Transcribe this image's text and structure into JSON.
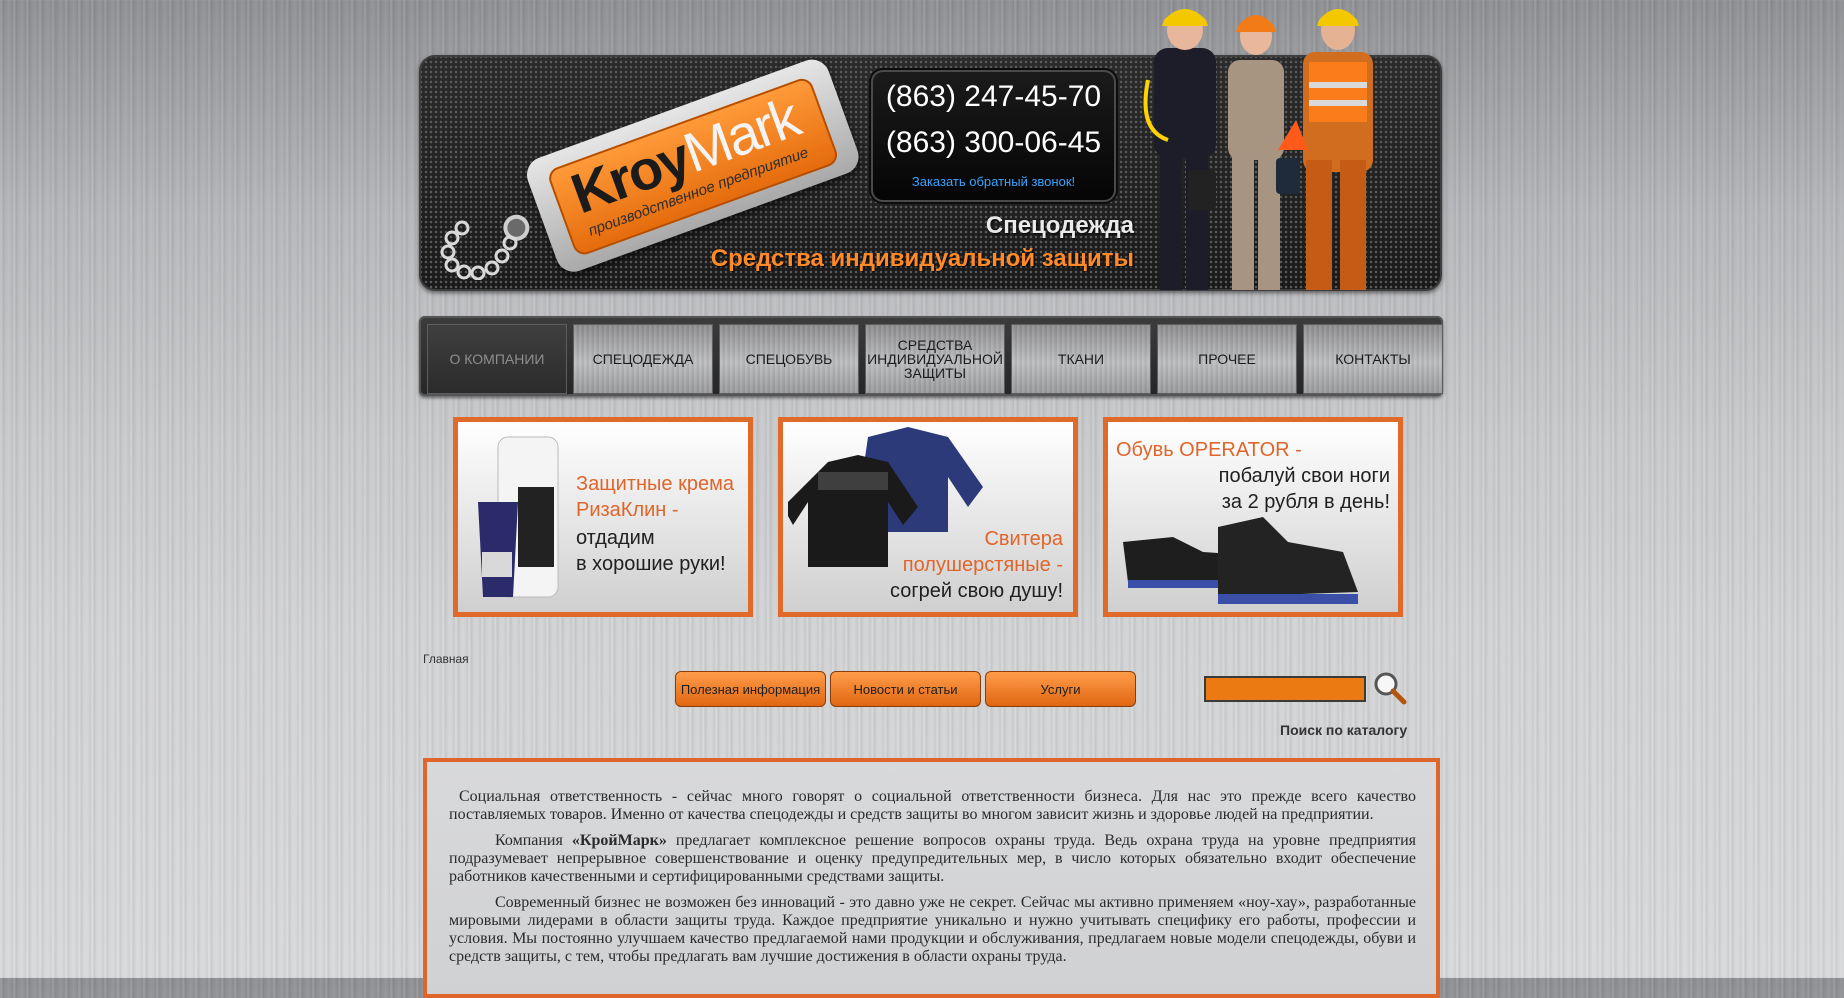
{
  "header": {
    "logo_word_a": "Kroy",
    "logo_word_b": "Mark",
    "logo_subtitle": "производственное предприятие",
    "phone1": "(863) 247-45-70",
    "phone2": "(863) 300-06-45",
    "callback_link": "Заказать обратный звонок!",
    "tagline1": "Спецодежда",
    "tagline2": "Средства индивидуальной защиты"
  },
  "nav": {
    "items": [
      {
        "label": "О компании",
        "active": true
      },
      {
        "label": "Спецодежда"
      },
      {
        "label": "Спецобувь"
      },
      {
        "label": "Средства индивидуальной защиты"
      },
      {
        "label": "Ткани"
      },
      {
        "label": "Прочее"
      },
      {
        "label": "Контакты"
      }
    ]
  },
  "banners": [
    {
      "lines": [
        "Защитные крема",
        "РизаКлин -",
        "отдадим",
        "в хорошие руки!"
      ]
    },
    {
      "lines": [
        "Свитера",
        "полушерстяные -",
        "согрей свою душу!"
      ]
    },
    {
      "lines": [
        "Обувь OPERATOR -",
        "побалуй свои ноги",
        "за 2 рубля в день!"
      ]
    }
  ],
  "breadcrumb": "Главная",
  "buttons": [
    "Полезная информация",
    "Новости и статьи",
    "Услуги"
  ],
  "search": {
    "caption": "Поиск по каталогу",
    "value": ""
  },
  "content": {
    "p1": "Социальная ответственность -  сейчас много говорят о социальной ответственности бизнеса. Для нас  это прежде всего качество поставляемых товаров. Именно от качества спецодежды и средств защиты во многом зависит жизнь и здоровье людей на предприятии.",
    "p2_a": "Компания ",
    "p2_b": "«КройМарк»",
    "p2_c": " предлагает комплексное решение вопросов охраны труда. Ведь охрана труда на уровне предприятия подразумевает непрерывное совершенствование и оценку предупредительных мер, в число которых обязательно входит обеспечение работников качественными и сертифицированными средствами защиты.",
    "p3": "Современный бизнес не возможен без инноваций -  это давно уже не секрет. Сейчас мы активно применяем  «ноу-хау», разработанные мировыми лидерами в области защиты труда.  Каждое предприятие уникально и  нужно учитывать специфику его работы, профессии и условия.  Мы постоянно улучшаем качество предлагаемой нами продукции и обслуживания, предлагаем новые модели спецодежды, обуви и средств защиты, с тем, чтобы предлагать вам лучшие достижения в области охраны труда."
  }
}
